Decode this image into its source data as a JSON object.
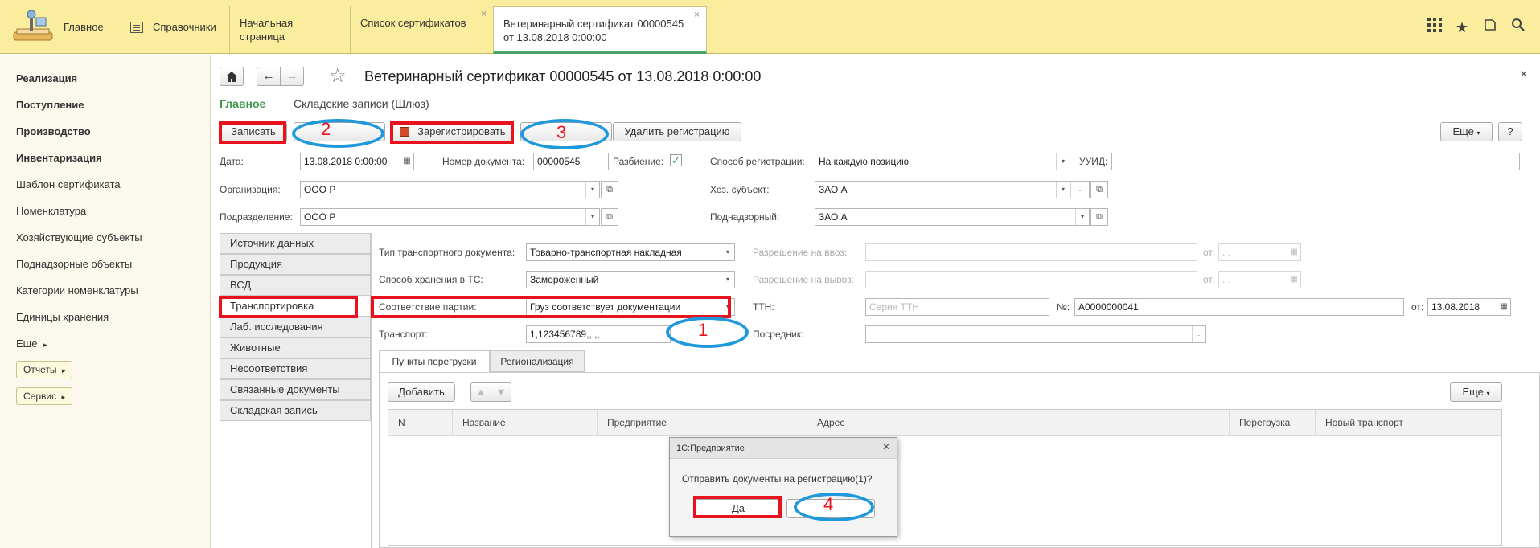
{
  "top": {
    "sections": [
      "Главное",
      "Справочники"
    ],
    "tabs": [
      {
        "label": "Начальная страница"
      },
      {
        "label": "Список сертификатов",
        "close": "×"
      },
      {
        "label_line1": "Ветеринарный сертификат 00000545",
        "label_line2": "от 13.08.2018 0:00:00",
        "close": "×"
      }
    ]
  },
  "sidebar": {
    "items": [
      "Реализация",
      "Поступление",
      "Производство",
      "Инвентаризация",
      "Шаблон сертификата",
      "Номенклатура",
      "Хозяйствующие субъекты",
      "Поднадзорные объекты",
      "Категории номенклатуры",
      "Единицы хранения",
      "Еще"
    ],
    "buttons": [
      "Отчеты",
      "Сервис"
    ]
  },
  "doc": {
    "title": "Ветеринарный сертификат 00000545 от 13.08.2018 0:00:00",
    "close": "×",
    "nav_main": "Главное",
    "nav_secondary": "Складские записи (Шлюз)"
  },
  "toolbar": {
    "save": "Записать",
    "register": "Зарегистрировать",
    "delete_registration": "Удалить регистрацию",
    "more": "Еще",
    "help": "?"
  },
  "form": {
    "date_label": "Дата:",
    "date_value": "13.08.2018  0:00:00",
    "docnum_label": "Номер документа:",
    "docnum_value": "00000545",
    "split_label": "Разбиение:",
    "regmethod_label": "Способ регистрации:",
    "regmethod_value": "На каждую позицию",
    "uuid_label": "УУИД:",
    "org_label": "Организация:",
    "org_value": "ООО Р",
    "subject_label": "Хоз. субъект:",
    "subject_value": "ЗАО  А",
    "division_label": "Подразделение:",
    "division_value": "ООО Р",
    "supervised_label": "Поднадзорный:",
    "supervised_value": "ЗАО А"
  },
  "side_tabs": [
    "Источник данных",
    "Продукция",
    "ВСД",
    "Транспортировка",
    "Лаб. исследования",
    "Животные",
    "Несоответствия",
    "Связанные документы",
    "Складская запись"
  ],
  "transport": {
    "doc_type_label": "Тип транспортного документа:",
    "doc_type_value": "Товарно-транспортная накладная",
    "storage_label": "Способ хранения в ТС:",
    "storage_value": "Замороженный",
    "match_label": "Соответствие партии:",
    "match_value": "Груз соответствует документации",
    "vehicle_label": "Транспорт:",
    "vehicle_value": "1,123456789,,,,,",
    "import_label": "Разрешение на ввоз:",
    "export_label": "Разрешение на вывоз:",
    "from_label": "от:",
    "from_placeholder": " .  .",
    "ttn_label": "ТТН:",
    "ttn_series_placeholder": "Серия ТТН",
    "ttn_no_label": "№:",
    "ttn_no_value": "А0000000041",
    "ttn_date_label": "от:",
    "ttn_date_value": "13.08.2018",
    "intermediary_label": "Посредник:",
    "subtabs": [
      "Пункты перегрузки",
      "Регионализация"
    ],
    "add": "Добавить",
    "more": "Еще",
    "grid_columns": [
      "N",
      "Название",
      "Предприятие",
      "Адрес",
      "Перегрузка",
      "Новый транспорт"
    ]
  },
  "dialog": {
    "title": "1С:Предприятие",
    "message": "Отправить документы на регистрацию(1)?",
    "yes": "Да",
    "close": "✕"
  },
  "annotations": [
    "1",
    "2",
    "3",
    "4"
  ],
  "colors": {
    "accent_green": "#3c9a4a",
    "top_bar": "#fbed9e",
    "marker_red": "#e8121e",
    "marker_blue": "#1f98dc"
  }
}
